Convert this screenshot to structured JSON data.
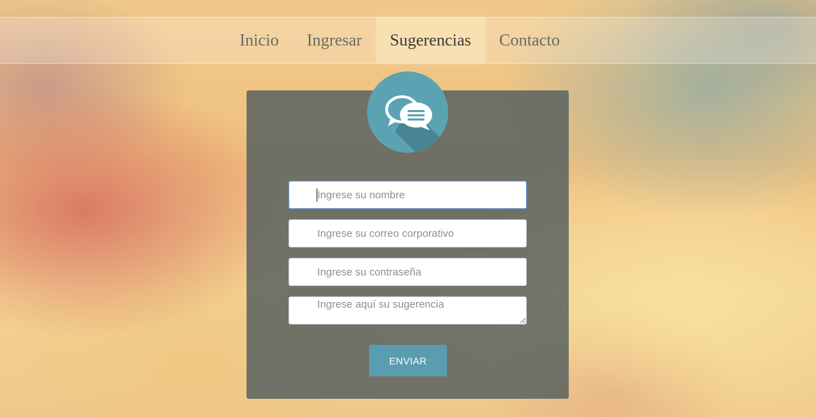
{
  "nav": {
    "items": [
      {
        "label": "Inicio"
      },
      {
        "label": "Ingresar"
      },
      {
        "label": "Sugerencias"
      },
      {
        "label": "Contacto"
      }
    ],
    "active": "Sugerencias"
  },
  "logo": {
    "icon": "chat-bubbles-icon"
  },
  "form": {
    "name_placeholder": "Ingrese su nombre",
    "email_placeholder": "Ingrese su correo corporativo",
    "password_placeholder": "Ingrese su contraseña",
    "suggestion_placeholder": "Ingrese aquí su sugerencia",
    "submit_label": "ENVIAR"
  },
  "colors": {
    "accent": "#5a9cb0",
    "panel": "#4b585c",
    "focus_border": "#6d9ed6"
  }
}
